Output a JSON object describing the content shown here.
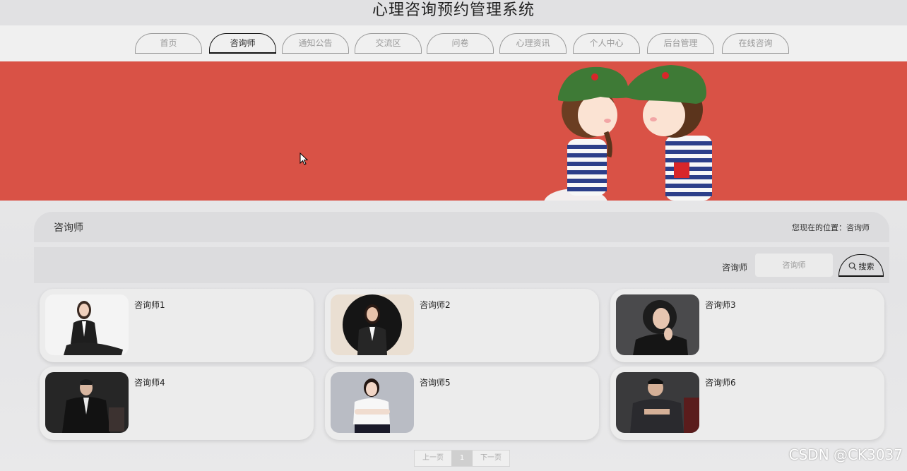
{
  "app": {
    "title": "心理咨询预约管理系统"
  },
  "nav": {
    "items": [
      {
        "label": "首页",
        "active": false
      },
      {
        "label": "咨询师",
        "active": true
      },
      {
        "label": "通知公告",
        "active": false
      },
      {
        "label": "交流区",
        "active": false
      },
      {
        "label": "问卷",
        "active": false
      },
      {
        "label": "心理资讯",
        "active": false
      },
      {
        "label": "个人中心",
        "active": false
      },
      {
        "label": "后台管理",
        "active": false
      },
      {
        "label": "在线咨询",
        "active": false
      }
    ]
  },
  "banner": {
    "background": "#d95246",
    "image": "cartoon-couple-illustration"
  },
  "section": {
    "title": "咨询师",
    "breadcrumb": "您现在的位置：咨询师"
  },
  "search": {
    "label": "咨询师",
    "placeholder": "咨询师",
    "button_label": "搜索",
    "button_icon": "search-icon"
  },
  "counselors": [
    {
      "name": "咨询师1"
    },
    {
      "name": "咨询师2"
    },
    {
      "name": "咨询师3"
    },
    {
      "name": "咨询师4"
    },
    {
      "name": "咨询师5"
    },
    {
      "name": "咨询师6"
    }
  ],
  "pagination": {
    "prev_label": "上一页",
    "current_page": "1",
    "next_label": "下一页"
  },
  "watermark": "CSDN @CK3037"
}
